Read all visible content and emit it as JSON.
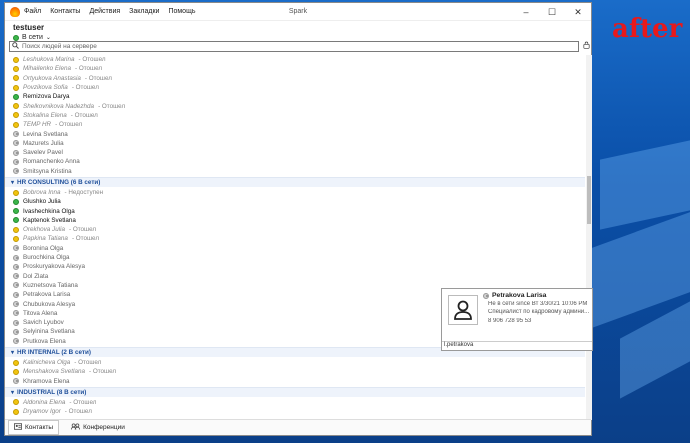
{
  "desktop": {
    "watermark": "after"
  },
  "window": {
    "title": "Spark",
    "menu": [
      "Файл",
      "Контакты",
      "Действия",
      "Закладки",
      "Помощь"
    ],
    "controls": {
      "minimize": "–",
      "maximize": "☐",
      "close": "✕"
    }
  },
  "user": {
    "name": "testuser",
    "status": "В сети"
  },
  "search": {
    "placeholder": "Поиск людей на сервере"
  },
  "groups": [
    {
      "header": null,
      "contacts": [
        {
          "name": "Leshukova Marina",
          "status": "away",
          "text": "- Отошел"
        },
        {
          "name": "Mihailenko Elena",
          "status": "away",
          "text": "- Отошел"
        },
        {
          "name": "Ortyukova Anastasia",
          "status": "away",
          "text": "- Отошел"
        },
        {
          "name": "Povzikova Sofia",
          "status": "away",
          "text": "- Отошел"
        },
        {
          "name": "Remizova Darya",
          "status": "online",
          "text": ""
        },
        {
          "name": "Shelkovnikova Nadezhda",
          "status": "away",
          "text": "- Отошел"
        },
        {
          "name": "Stokalina Elena",
          "status": "away",
          "text": "- Отошел"
        },
        {
          "name": "TEMP HR",
          "status": "away",
          "text": "- Отошел"
        },
        {
          "name": "Levina Svetlana",
          "status": "offline",
          "text": ""
        },
        {
          "name": "Mazurets Julia",
          "status": "offline",
          "text": ""
        },
        {
          "name": "Savelev Pavel",
          "status": "offline",
          "text": ""
        },
        {
          "name": "Romanchenko Anna",
          "status": "offline",
          "text": ""
        },
        {
          "name": "Smitsyna Kristina",
          "status": "offline",
          "text": ""
        }
      ]
    },
    {
      "header": "HR CONSULTING (6 В сети)",
      "contacts": [
        {
          "name": "Bobrova Inna",
          "status": "away",
          "text": "- Недоступен"
        },
        {
          "name": "Glushko Julia",
          "status": "online",
          "text": ""
        },
        {
          "name": "Ivashechkina Olga",
          "status": "online",
          "text": ""
        },
        {
          "name": "Kaptenok Svetlana",
          "status": "online",
          "text": ""
        },
        {
          "name": "Orekhova Julia",
          "status": "away",
          "text": "- Отошел"
        },
        {
          "name": "Papkina Tatiana",
          "status": "away",
          "text": "- Отошел"
        },
        {
          "name": "Boronina Olga",
          "status": "offline",
          "text": ""
        },
        {
          "name": "Burochkina Olga",
          "status": "offline",
          "text": ""
        },
        {
          "name": "Proskuryakova Alesya",
          "status": "offline",
          "text": ""
        },
        {
          "name": "Dol Zlata",
          "status": "offline",
          "text": ""
        },
        {
          "name": "Kuznetsova Tatiana",
          "status": "offline",
          "text": ""
        },
        {
          "name": "Petrakova Larisa",
          "status": "offline",
          "text": ""
        },
        {
          "name": "Chubukova Alesya",
          "status": "offline",
          "text": ""
        },
        {
          "name": "Titova Alena",
          "status": "offline",
          "text": ""
        },
        {
          "name": "Savich Lyubov",
          "status": "offline",
          "text": ""
        },
        {
          "name": "Selyinina Svetlana",
          "status": "offline",
          "text": ""
        },
        {
          "name": "Prutkova Elena",
          "status": "offline",
          "text": ""
        }
      ]
    },
    {
      "header": "HR INTERNAL (2 В сети)",
      "contacts": [
        {
          "name": "Kalinicheva Olga",
          "status": "away",
          "text": "- Отошел"
        },
        {
          "name": "Menshakova Svetlana",
          "status": "away",
          "text": "- Отошел"
        },
        {
          "name": "Khramova Elena",
          "status": "offline",
          "text": ""
        }
      ]
    },
    {
      "header": "INDUSTRIAL (8 В сети)",
      "contacts": [
        {
          "name": "Aldonina Elena",
          "status": "away",
          "text": "- Отошел"
        },
        {
          "name": "Dryamov Igor",
          "status": "away",
          "text": "- Отошел"
        }
      ]
    }
  ],
  "popup": {
    "name": "Petrakova Larisa",
    "line1": "Не в сети since Вт 3/30/21 10:06 PM",
    "line2": "Специалист по кадровому админи...",
    "line3": "8 906 728 95 53",
    "footer": "l.petrakova"
  },
  "tabs": [
    {
      "label": "Контакты",
      "icon": "contacts-icon"
    },
    {
      "label": "Конференции",
      "icon": "conference-icon"
    }
  ],
  "colors": {
    "away": "#f1c40f",
    "online": "#3bb54a",
    "offline": "#cfcfcf",
    "group": "#1f4f9a"
  }
}
